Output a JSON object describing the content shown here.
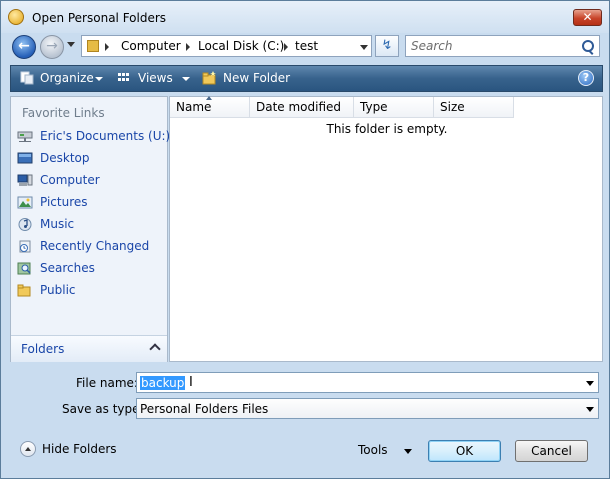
{
  "window": {
    "title": "Open Personal Folders",
    "close_glyph": "✕"
  },
  "nav": {
    "back_glyph": "←",
    "forward_glyph": "→",
    "breadcrumb": [
      "Computer",
      "Local Disk (C:)",
      "test"
    ],
    "search_placeholder": "Search",
    "refresh_glyph": "↯"
  },
  "toolbar": {
    "organize": "Organize",
    "views": "Views",
    "new_folder": "New Folder",
    "help_glyph": "?"
  },
  "sidebar": {
    "title": "Favorite Links",
    "items": [
      {
        "label": "Eric's Documents (U:)",
        "icon": "network-drive-icon"
      },
      {
        "label": "Desktop",
        "icon": "desktop-icon"
      },
      {
        "label": "Computer",
        "icon": "computer-icon"
      },
      {
        "label": "Pictures",
        "icon": "pictures-icon"
      },
      {
        "label": "Music",
        "icon": "music-icon"
      },
      {
        "label": "Recently Changed",
        "icon": "recent-icon"
      },
      {
        "label": "Searches",
        "icon": "searches-icon"
      },
      {
        "label": "Public",
        "icon": "folder-icon"
      }
    ],
    "folders_label": "Folders"
  },
  "filelist": {
    "columns": [
      "Name",
      "Date modified",
      "Type",
      "Size"
    ],
    "empty_message": "This folder is empty."
  },
  "form": {
    "file_name_label": "File name:",
    "file_name_value": "backup",
    "save_type_label": "Save as type:",
    "save_type_value": "Personal Folders Files"
  },
  "footer": {
    "hide_folders": "Hide Folders",
    "tools": "Tools",
    "ok": "OK",
    "cancel": "Cancel"
  },
  "colors": {
    "toolbar": "#37628c",
    "link": "#1a46a8",
    "selection": "#3399ff",
    "close_button": "#c8442a"
  }
}
